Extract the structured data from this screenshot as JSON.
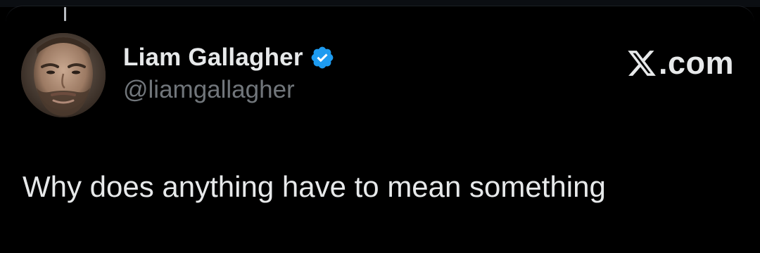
{
  "tweet": {
    "author": {
      "display_name": "Liam Gallagher",
      "handle": "@liamgallagher",
      "verified": true,
      "verified_badge_color": "#1d9bf0",
      "avatar_icon": "profile-photo"
    },
    "brand": {
      "logo_icon": "x-logo-icon",
      "domain_suffix": ".com"
    },
    "text": "Why does anything have to mean something"
  },
  "theme": {
    "background": "#000000",
    "primary_text": "#e7e9ea",
    "secondary_text": "#71767b"
  }
}
